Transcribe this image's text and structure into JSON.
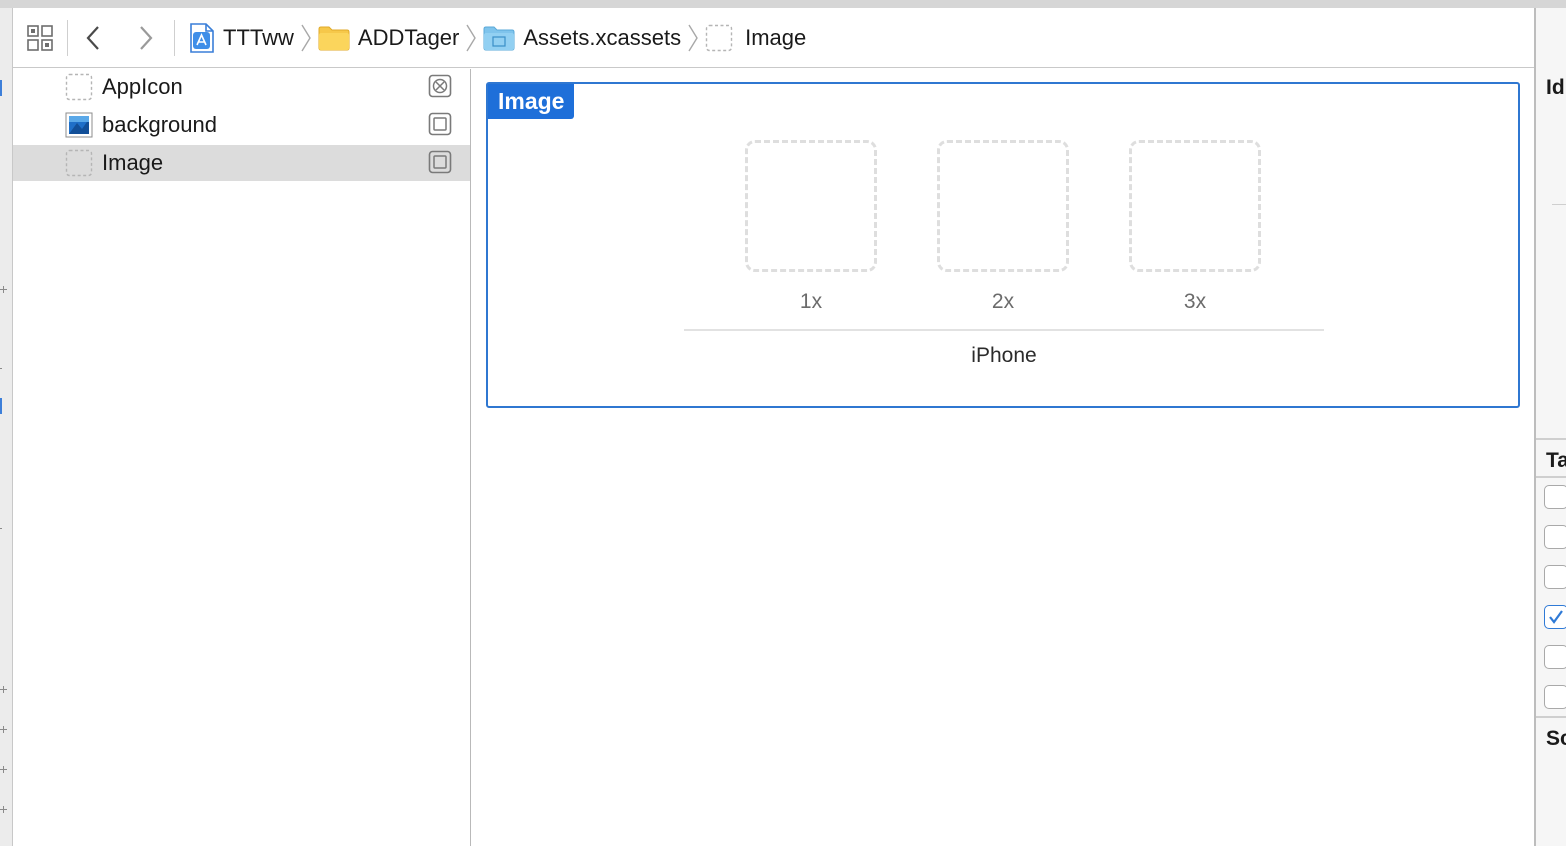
{
  "jumpbar": {
    "crumbs": [
      {
        "label": "TTTww",
        "icon": "xcode-project-icon"
      },
      {
        "label": "ADDTager",
        "icon": "folder-icon"
      },
      {
        "label": "Assets.xcassets",
        "icon": "asset-catalog-folder-icon"
      },
      {
        "label": "Image",
        "icon": "image-set-icon"
      }
    ]
  },
  "outline": {
    "items": [
      {
        "label": "AppIcon",
        "icon": "app-icon-set-icon",
        "badge": "warning-x-icon",
        "selected": false
      },
      {
        "label": "background",
        "icon": "image-thumbnail-icon",
        "badge": "square-icon",
        "selected": false
      },
      {
        "label": "Image",
        "icon": "image-set-icon",
        "badge": "square-icon",
        "selected": true
      }
    ]
  },
  "editor": {
    "set_name": "Image",
    "slots": [
      {
        "scale": "1x"
      },
      {
        "scale": "2x"
      },
      {
        "scale": "3x"
      }
    ],
    "idiom": "iPhone"
  },
  "inspector": {
    "section_identity": "Id",
    "section_target": "Ta",
    "section_source": "Sc",
    "checkboxes": [
      false,
      false,
      false,
      true,
      false,
      false
    ]
  },
  "colors": {
    "accent": "#1e6fd9",
    "selection": "#dcdcdc",
    "folder": "#f5c342"
  }
}
